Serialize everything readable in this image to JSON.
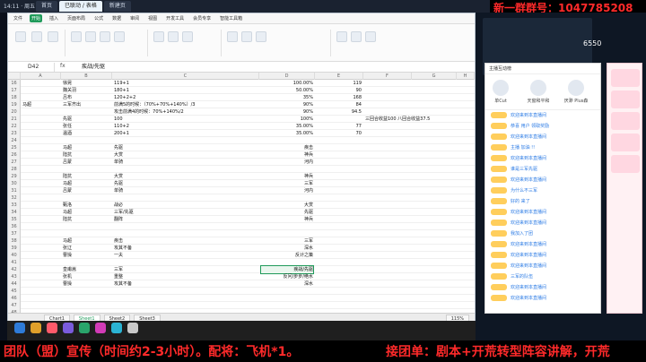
{
  "topbar": {
    "time": "14:11 · 周五",
    "tabs": [
      "首页",
      "已联动 / 表格",
      "新建页"
    ],
    "banner": "新一群群号：1047785208"
  },
  "spreadsheet": {
    "ribbon_tabs": [
      "文件",
      "开始",
      "插入",
      "页面布局",
      "公式",
      "数据",
      "审阅",
      "视图",
      "开发工具",
      "会员专享",
      "智能工具箱"
    ],
    "active_ribbon_tab": "开始",
    "namebox": "D42",
    "fx": "fx",
    "formula": "疾战/先驱",
    "columns": [
      "A",
      "B",
      "C",
      "D",
      "E",
      "F",
      "G",
      "H",
      "I"
    ],
    "rows": [
      {
        "n": "16",
        "A": "",
        "B": "徐晃",
        "C": "119+1",
        "D": "100.00%",
        "E": "119",
        "F": ""
      },
      {
        "n": "17",
        "A": "",
        "B": "魏关羽",
        "C": "180+1",
        "D": "50.00%",
        "E": "90",
        "F": ""
      },
      {
        "n": "18",
        "A": "",
        "B": "吕布",
        "C": "120+2+2",
        "D": "35%",
        "E": "168",
        "F": ""
      },
      {
        "n": "19",
        "A": "马超",
        "B": "三军齐出",
        "C": "前满5的时候：（70%+70%+140%）/3",
        "D": "90%",
        "E": "84",
        "F": ""
      },
      {
        "n": "20",
        "A": "",
        "B": "",
        "C": "攻击前满4的时候：70%+140%/2",
        "D": "90%",
        "E": "94.5",
        "F": ""
      },
      {
        "n": "21",
        "A": "",
        "B": "先驱",
        "C": "100",
        "D": "100%",
        "E": "",
        "F": "三回合收益100  八回合收益37.5"
      },
      {
        "n": "22",
        "A": "",
        "B": "张任",
        "C": "110+2",
        "D": "35.00%",
        "E": "77",
        "F": ""
      },
      {
        "n": "23",
        "A": "",
        "B": "温酒",
        "C": "200+1",
        "D": "35.00%",
        "E": "70",
        "F": ""
      },
      {
        "n": "24",
        "A": "",
        "B": "",
        "C": "",
        "D": "",
        "E": "",
        "F": ""
      },
      {
        "n": "25",
        "A": "",
        "B": "马超",
        "C": "先驱",
        "D": "疾击",
        "E": "",
        "F": ""
      },
      {
        "n": "26",
        "A": "",
        "B": "陆抗",
        "C": "大赏",
        "D": "神兵",
        "E": "",
        "F": ""
      },
      {
        "n": "27",
        "A": "",
        "B": "吕蒙",
        "C": "单骑",
        "D": "河内",
        "E": "",
        "F": ""
      },
      {
        "n": "28",
        "A": "",
        "B": "",
        "C": "",
        "D": "",
        "E": "",
        "F": ""
      },
      {
        "n": "29",
        "A": "",
        "B": "陆抗",
        "C": "大赏",
        "D": "神兵",
        "E": "",
        "F": ""
      },
      {
        "n": "30",
        "A": "",
        "B": "马超",
        "C": "先驱",
        "D": "三军",
        "E": "",
        "F": ""
      },
      {
        "n": "31",
        "A": "",
        "B": "吕蒙",
        "C": "单骑",
        "D": "河内",
        "E": "",
        "F": ""
      },
      {
        "n": "32",
        "A": "",
        "B": "",
        "C": "",
        "D": "",
        "E": "",
        "F": ""
      },
      {
        "n": "33",
        "A": "",
        "B": "甄洛",
        "C": "战必",
        "D": "大赏",
        "E": "",
        "F": ""
      },
      {
        "n": "34",
        "A": "",
        "B": "马超",
        "C": "三军/先驱",
        "D": "先驱",
        "E": "",
        "F": ""
      },
      {
        "n": "35",
        "A": "",
        "B": "陆抗",
        "C": "翻阵",
        "D": "神兵",
        "E": "",
        "F": ""
      },
      {
        "n": "36",
        "A": "",
        "B": "",
        "C": "",
        "D": "",
        "E": "",
        "F": ""
      },
      {
        "n": "37",
        "A": "",
        "B": "",
        "C": "",
        "D": "",
        "E": "",
        "F": ""
      },
      {
        "n": "38",
        "A": "",
        "B": "马超",
        "C": "疾击",
        "D": "三军",
        "E": "",
        "F": ""
      },
      {
        "n": "39",
        "A": "",
        "B": "张辽",
        "C": "攻其不备",
        "D": "深水",
        "E": "",
        "F": ""
      },
      {
        "n": "40",
        "A": "",
        "B": "曹操",
        "C": "一夫",
        "D": "反计之策",
        "E": "",
        "F": ""
      },
      {
        "n": "41",
        "A": "",
        "B": "",
        "C": "",
        "D": "",
        "E": "",
        "F": ""
      },
      {
        "n": "42",
        "A": "",
        "B": "皇甫嵩",
        "C": "三军",
        "D": "疾战/先驱",
        "E": "",
        "F": ""
      },
      {
        "n": "43",
        "A": "",
        "B": "张机",
        "C": "重整",
        "D": "反问/步步/绝水",
        "E": "",
        "F": ""
      },
      {
        "n": "44",
        "A": "",
        "B": "曹操",
        "C": "攻其不备",
        "D": "深水",
        "E": "",
        "F": ""
      },
      {
        "n": "45",
        "A": "",
        "B": "",
        "C": "",
        "D": "",
        "E": "",
        "F": ""
      },
      {
        "n": "46",
        "A": "",
        "B": "",
        "C": "",
        "D": "",
        "E": "",
        "F": ""
      },
      {
        "n": "47",
        "A": "",
        "B": "",
        "C": "",
        "D": "",
        "E": "",
        "F": ""
      },
      {
        "n": "48",
        "A": "",
        "B": "",
        "C": "",
        "D": "",
        "E": "",
        "F": ""
      },
      {
        "n": "49",
        "A": "",
        "B": "",
        "C": "",
        "D": "",
        "E": "",
        "F": ""
      }
    ],
    "sheet_tabs": [
      "Chart1",
      "Sheet1",
      "Sheet2",
      "Sheet3"
    ],
    "active_sheet": "Sheet1",
    "zoom": "115%"
  },
  "stream": {
    "cam_label": "6550",
    "chat_header": "主播互动榜",
    "gift_labels": [
      "单Cut",
      "天窗和平和",
      "厌渺 Plus森"
    ],
    "chat": [
      "欢迎来到本直播间",
      "恭喜 用户 领取奖励",
      "欢迎来到本直播间",
      "主播 加油 !!",
      "欢迎来到本直播间",
      "谁是三军先驱",
      "欢迎来到本直播间",
      "为什么不三军",
      "好的 来了",
      "欢迎来到本直播间",
      "欢迎来到本直播间",
      "我加入了团",
      "欢迎来到本直播间",
      "欢迎来到本直播间",
      "欢迎来到本直播间",
      "三军的队伍",
      "欢迎来到本直播间",
      "欢迎来到本直播间"
    ]
  },
  "ticker": {
    "left": "团队（盟）宣传（时间约2-3小时）。配将：飞机*1。",
    "right": "接团单：剧本+开荒转型阵容讲解，开荒"
  }
}
